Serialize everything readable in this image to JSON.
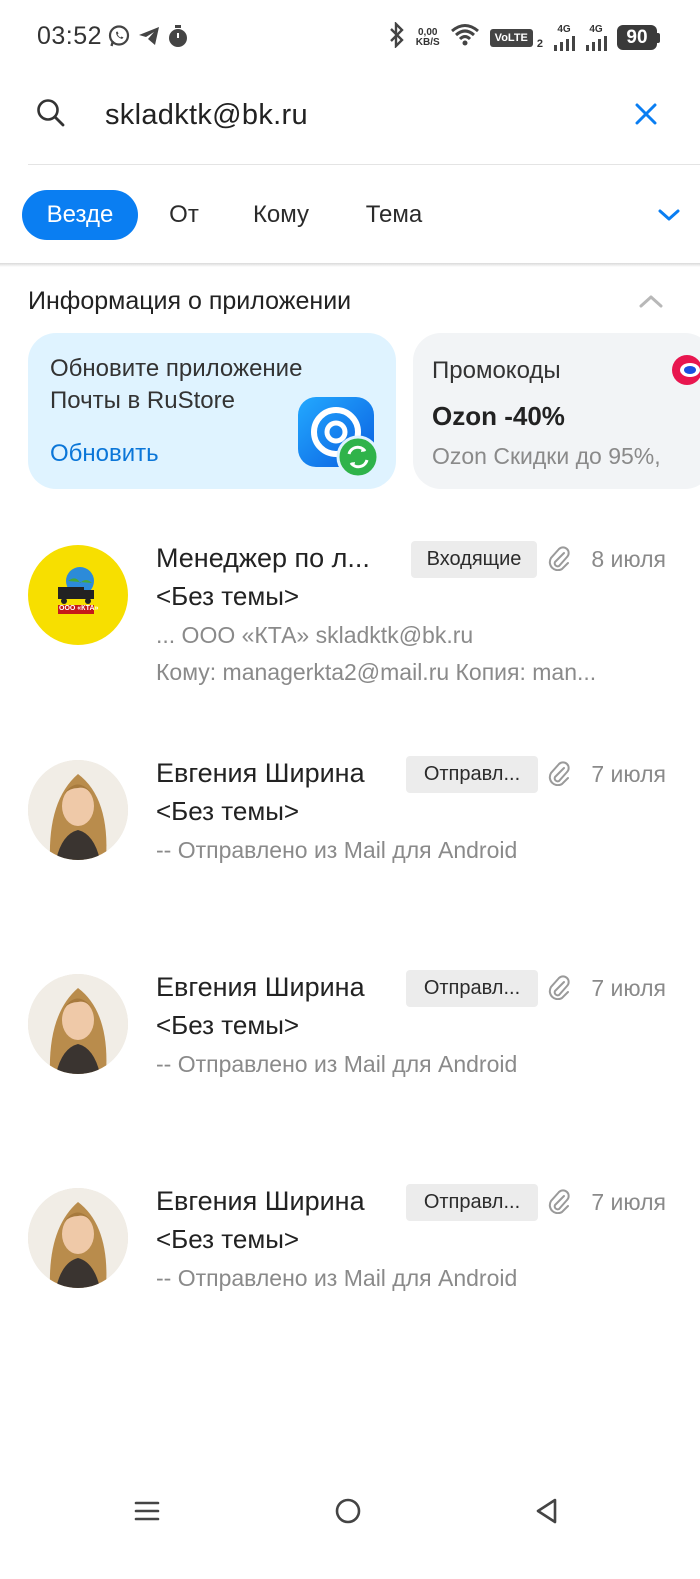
{
  "status_bar": {
    "time": "03:52",
    "net_speed_value": "0,00",
    "net_speed_unit": "KB/S",
    "volte_label": "VoLTE",
    "sim_index": "2",
    "signal1_label": "4G",
    "signal2_label": "4G",
    "battery": "90",
    "icons": [
      "whatsapp-icon",
      "telegram-icon",
      "timer-icon",
      "bluetooth-icon",
      "wifi-icon"
    ]
  },
  "search": {
    "query": "skladktk@bk.ru"
  },
  "filters": {
    "chips": [
      "Везде",
      "От",
      "Кому",
      "Тема"
    ],
    "active": "Везде"
  },
  "info_section": {
    "title": "Информация о приложении",
    "rustore_card": {
      "text": "Обновите приложение Почты в RuStore",
      "link": "Обновить"
    },
    "promo_card": {
      "label": "Промокоды",
      "title": "Ozon -40%",
      "subtitle": "Ozon Скидки до 95%,"
    }
  },
  "emails": [
    {
      "sender": "Менеджер по л...",
      "folder": "Входящие",
      "date": "8 июля",
      "subject": "<Без темы>",
      "snippet1": "... ООО «КТА» skladktk@bk.ru",
      "snippet2": "Кому: managerkta2@mail.ru Копия: man...",
      "avatar_text": "ООО «КТА»"
    },
    {
      "sender": "Евгения Ширина",
      "folder": "Отправл...",
      "date": "7 июля",
      "subject": "<Без темы>",
      "snippet1": "-- Отправлено из Mail для Android"
    },
    {
      "sender": "Евгения Ширина",
      "folder": "Отправл...",
      "date": "7 июля",
      "subject": "<Без темы>",
      "snippet1": "-- Отправлено из Mail для Android"
    },
    {
      "sender": "Евгения Ширина",
      "folder": "Отправл...",
      "date": "7 июля",
      "subject": "<Без темы>",
      "snippet1": "-- Отправлено из Mail для Android"
    }
  ],
  "colors": {
    "accent": "#0a7ef2",
    "link": "#0b76d8",
    "rustore_card_bg": "#dff3ff",
    "promo_card_bg": "#f2f4f6",
    "muted_text": "#8a8a8a"
  }
}
